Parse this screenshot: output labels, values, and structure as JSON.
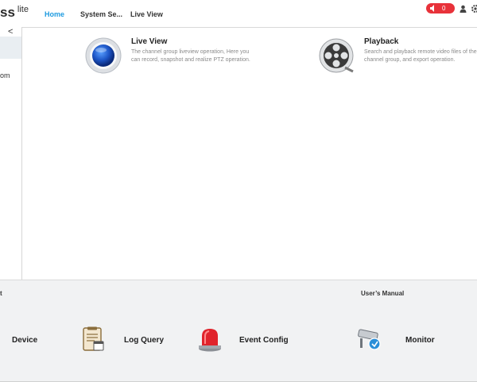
{
  "brand": {
    "name": "ss",
    "suffix": "lite"
  },
  "nav": {
    "tabs": [
      {
        "label": "Home",
        "active": true
      },
      {
        "label": "System Se...",
        "active": false
      },
      {
        "label": "Live View",
        "active": false
      }
    ]
  },
  "header": {
    "alarm_count": "0",
    "alarm_color": "#e8323a"
  },
  "sidebar": {
    "collapse_glyph": "<",
    "partial_item": "om"
  },
  "modules": [
    {
      "title": "Live View",
      "icon": "live-view-icon",
      "description": "The channel group liveview operation, Here you can record, snapshot and realize PTZ operation."
    },
    {
      "title": "Playback",
      "icon": "film-reel-icon",
      "description": "Search and playback remote video files of the channel group, and export operation."
    }
  ],
  "bottom": {
    "partial_heading": "t",
    "manual_label": "User’s Manual",
    "tools": [
      {
        "label": "Device",
        "icon": "device-icon"
      },
      {
        "label": "Log Query",
        "icon": "log-icon"
      },
      {
        "label": "Event Config",
        "icon": "alarm-light-icon"
      },
      {
        "label": "Monitor",
        "icon": "camera-icon"
      }
    ]
  },
  "colors": {
    "accent": "#1e9be0",
    "alarm": "#e8323a"
  }
}
